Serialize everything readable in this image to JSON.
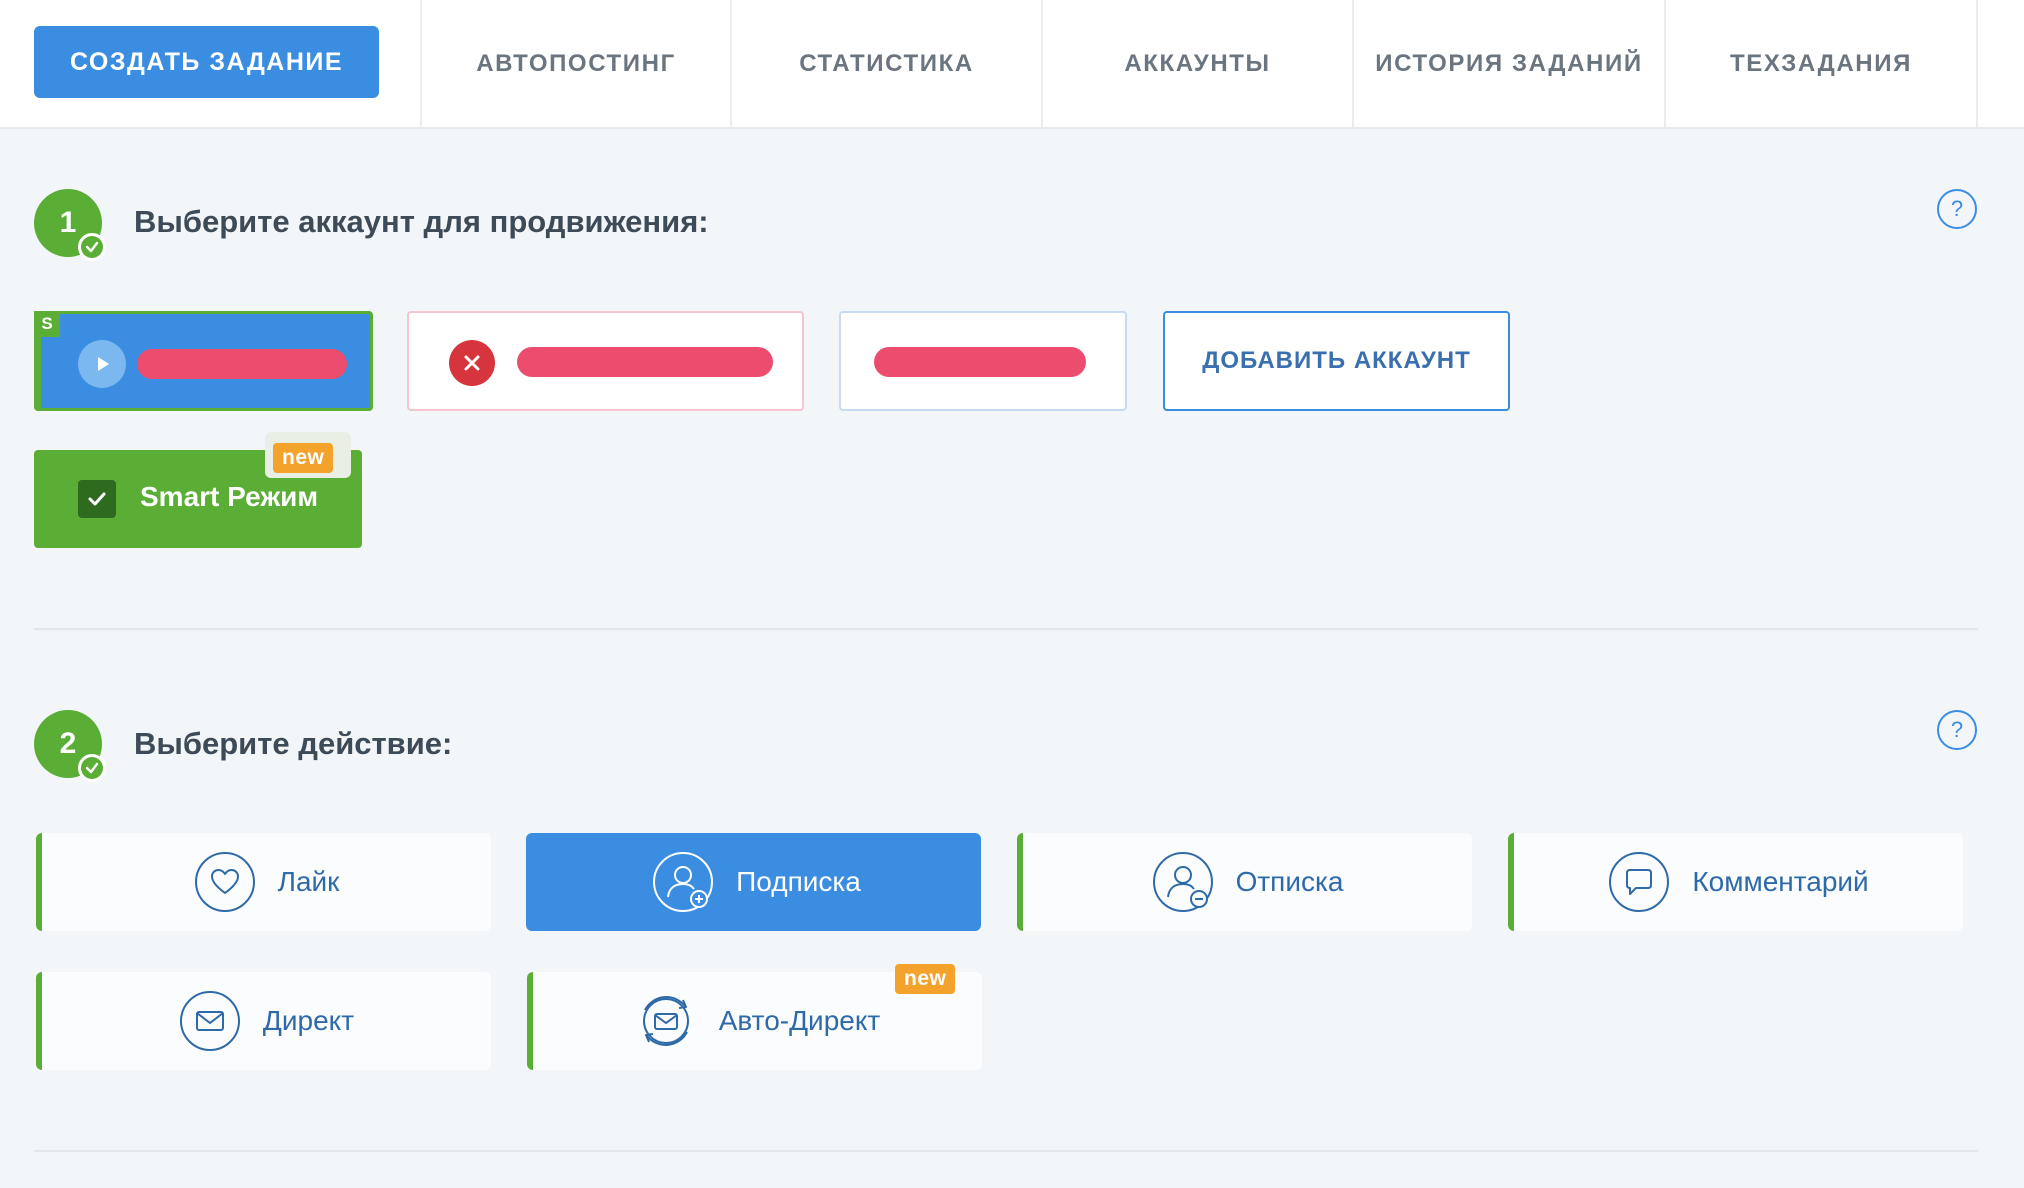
{
  "topnav": {
    "create_button": "СОЗДАТЬ ЗАДАНИЕ",
    "tabs": [
      {
        "label": "АВТОПОСТИНГ"
      },
      {
        "label": "СТАТИСТИКА"
      },
      {
        "label": "АККАУНТЫ"
      },
      {
        "label": "ИСТОРИЯ ЗАДАНИЙ"
      },
      {
        "label": "ТЕХЗАДАНИЯ"
      }
    ]
  },
  "step1": {
    "number": "1",
    "title": "Выберите аккаунт для продвижения:",
    "help": "?",
    "accounts": [
      {
        "state": "active",
        "badge": "S"
      },
      {
        "state": "error"
      },
      {
        "state": "plain"
      }
    ],
    "add_account": "ДОБАВИТЬ АККАУНТ",
    "smart_mode": {
      "label": "Smart Режим",
      "checked": true,
      "badge": "new"
    }
  },
  "step2": {
    "number": "2",
    "title": "Выберите действие:",
    "help": "?",
    "actions": [
      {
        "label": "Лайк",
        "icon": "heart-icon",
        "selected": false
      },
      {
        "label": "Подписка",
        "icon": "user-plus-icon",
        "selected": true
      },
      {
        "label": "Отписка",
        "icon": "user-minus-icon",
        "selected": false
      },
      {
        "label": "Комментарий",
        "icon": "comment-icon",
        "selected": false
      },
      {
        "label": "Директ",
        "icon": "envelope-icon",
        "selected": false
      },
      {
        "label": "Авто-Директ",
        "icon": "auto-envelope-icon",
        "selected": false,
        "badge": "new"
      }
    ]
  },
  "colors": {
    "primary": "#3a8de0",
    "success": "#5aae35",
    "error": "#d6353d",
    "badge": "#f3a22c",
    "redacted": "#ec4d6e"
  }
}
